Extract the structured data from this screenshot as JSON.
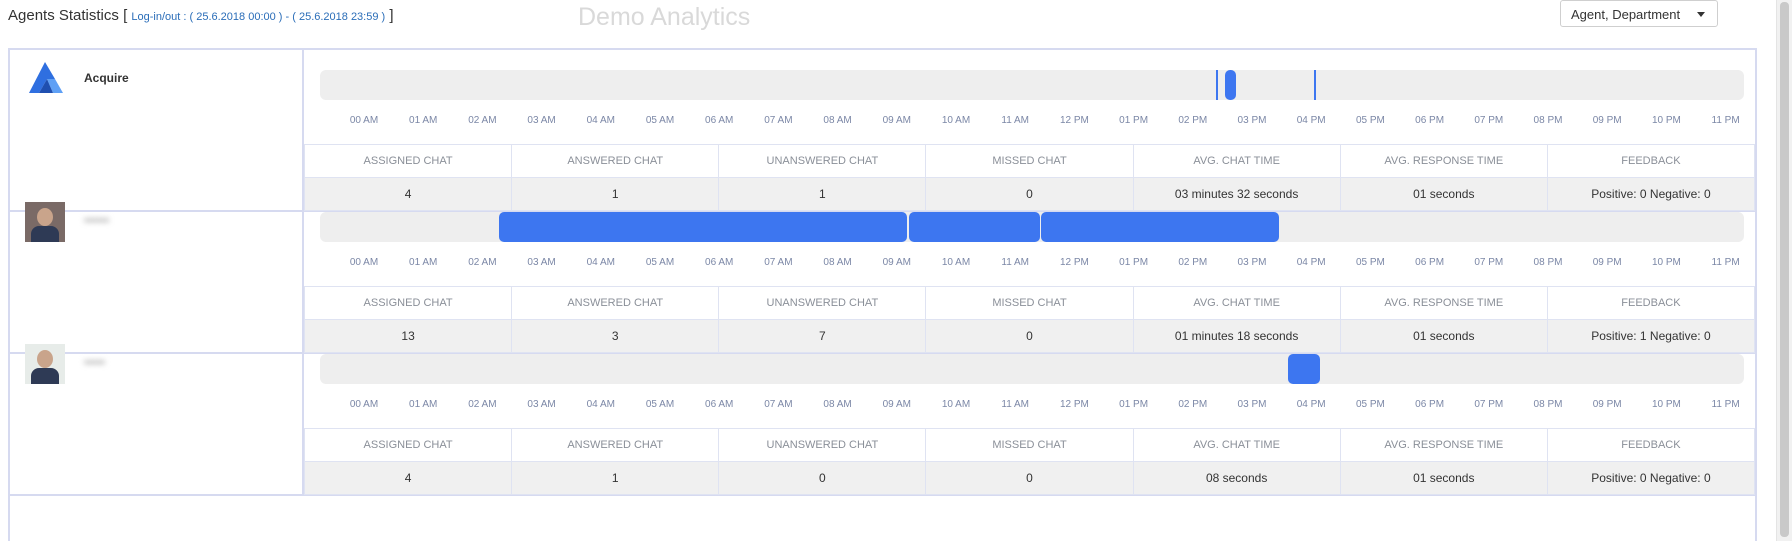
{
  "header": {
    "title": "Agents Statistics",
    "bracket_open": "[",
    "range": "Log-in/out : ( 25.6.2018 00:00 ) - ( 25.6.2018 23:59 )",
    "bracket_close": "]",
    "watermark": "Demo Analytics",
    "group_by": {
      "selected": "Agent, Department"
    }
  },
  "hours": [
    "00 AM",
    "01 AM",
    "02 AM",
    "03 AM",
    "04 AM",
    "05 AM",
    "06 AM",
    "07 AM",
    "08 AM",
    "09 AM",
    "10 AM",
    "11 AM",
    "12 PM",
    "01 PM",
    "02 PM",
    "03 PM",
    "04 PM",
    "05 PM",
    "06 PM",
    "07 PM",
    "08 PM",
    "09 PM",
    "10 PM",
    "11 PM"
  ],
  "columns": [
    "ASSIGNED CHAT",
    "ANSWERED CHAT",
    "UNANSWERED CHAT",
    "MISSED CHAT",
    "AVG. CHAT TIME",
    "AVG. RESPONSE TIME",
    "FEEDBACK"
  ],
  "colors": {
    "accent": "#3d76f0",
    "track": "#eeeeee",
    "border": "#d6daf0"
  },
  "agents": [
    {
      "name": "Acquire",
      "avatar": "acquire-logo",
      "activity_hours": [
        {
          "start": 14.4,
          "end": 14.45
        },
        {
          "start": 14.55,
          "end": 14.73
        },
        {
          "start": 16.05,
          "end": 16.1
        }
      ],
      "stats": [
        "4",
        "1",
        "1",
        "0",
        "03 minutes 32 seconds",
        "01 seconds",
        "Positive: 0 Negative: 0"
      ]
    },
    {
      "name": "••••••",
      "avatar": "agent-photo",
      "activity_hours": [
        {
          "start": 2.28,
          "end": 9.18
        },
        {
          "start": 9.2,
          "end": 11.42
        },
        {
          "start": 11.44,
          "end": 15.45
        }
      ],
      "stats": [
        "13",
        "3",
        "7",
        "0",
        "01 minutes 18 seconds",
        "01 seconds",
        "Positive: 1 Negative: 0"
      ]
    },
    {
      "name": "•••••",
      "avatar": "agent-photo",
      "activity_hours": [
        {
          "start": 15.6,
          "end": 16.15
        }
      ],
      "stats": [
        "4",
        "1",
        "0",
        "0",
        "08 seconds",
        "01 seconds",
        "Positive: 0 Negative: 0"
      ]
    }
  ]
}
